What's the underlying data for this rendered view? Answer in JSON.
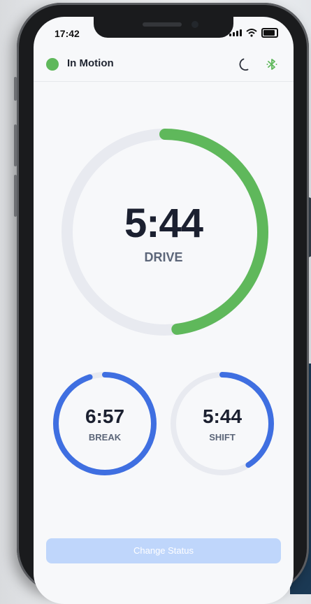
{
  "statusbar": {
    "time": "17:42"
  },
  "header": {
    "status_label": "In Motion",
    "status_color": "#5fb85b",
    "icons": [
      "moon-icon",
      "bluetooth-icon"
    ]
  },
  "drive": {
    "time": "5:44",
    "label": "DRIVE",
    "progress_fraction": 0.48,
    "ring_color": "#5fb85b",
    "track_color": "#e8eaf0"
  },
  "break": {
    "time": "6:57",
    "label": "BREAK",
    "progress_fraction": 0.95,
    "ring_color": "#3f6fe1"
  },
  "shift": {
    "time": "5:44",
    "label": "SHIFT",
    "progress_fraction": 0.41,
    "ring_color": "#3f6fe1"
  },
  "actions": {
    "change_status": "Change Status"
  }
}
